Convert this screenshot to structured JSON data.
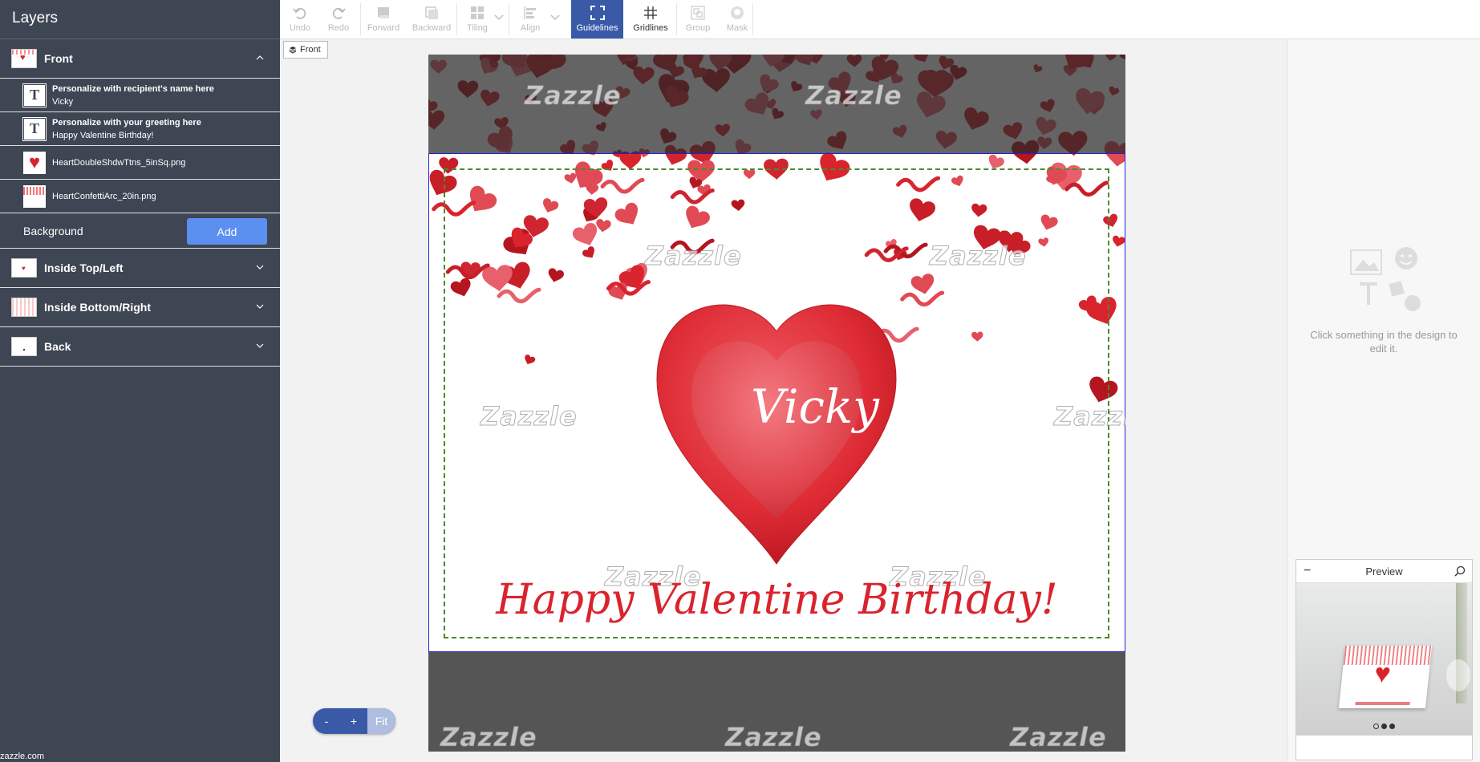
{
  "sidebar": {
    "title": "Layers",
    "front": {
      "label": "Front",
      "layers": [
        {
          "name": "Personalize with recipient's name here",
          "value": "Vicky"
        },
        {
          "name": "Personalize with your greeting here",
          "value": "Happy Valentine Birthday!"
        },
        {
          "name": "HeartDoubleShdwTtns_5inSq.png"
        },
        {
          "name": "HeartConfettiArc_20in.png"
        }
      ],
      "background_label": "Background",
      "add_label": "Add"
    },
    "sections": [
      {
        "label": "Inside Top/Left"
      },
      {
        "label": "Inside Bottom/Right"
      },
      {
        "label": "Back"
      }
    ]
  },
  "status_url": "zazzle.com",
  "toolbar": {
    "undo": "Undo",
    "redo": "Redo",
    "forward": "Forward",
    "backward": "Backward",
    "tiling": "Tiling",
    "align": "Align",
    "guidelines": "Guidelines",
    "gridlines": "Gridlines",
    "group": "Group",
    "mask": "Mask"
  },
  "canvas": {
    "side_tag": "Front",
    "name_text": "Vicky",
    "greeting_text": "Happy Valentine Birthday!",
    "watermark": "Zazzle",
    "colors": {
      "accent_red": "#d9232d",
      "guide_blue": "#2222dd",
      "safe_green": "#4b8a2a"
    }
  },
  "right_panel": {
    "hint": "Click something in the design to edit it."
  },
  "preview": {
    "title": "Preview",
    "minus": "−"
  },
  "zoom": {
    "minus": "-",
    "plus": "+",
    "fit": "Fit"
  },
  "colors": {
    "sidebar_bg": "#3e4553",
    "active_tool": "#3a5aa8",
    "add_button": "#5b8ff0"
  }
}
